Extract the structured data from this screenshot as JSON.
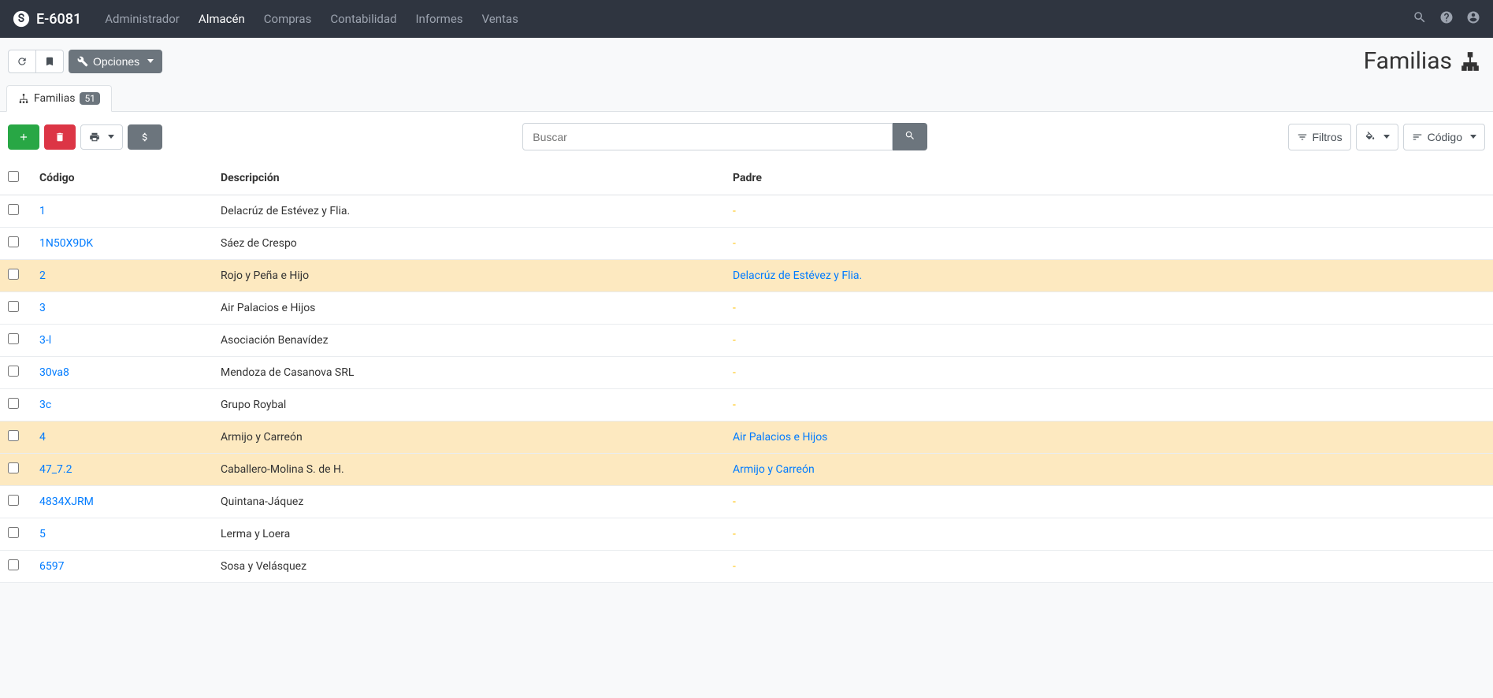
{
  "brand": "E-6081",
  "nav": [
    {
      "label": "Administrador",
      "active": false
    },
    {
      "label": "Almacén",
      "active": true
    },
    {
      "label": "Compras",
      "active": false
    },
    {
      "label": "Contabilidad",
      "active": false
    },
    {
      "label": "Informes",
      "active": false
    },
    {
      "label": "Ventas",
      "active": false
    }
  ],
  "toolbar": {
    "opciones": "Opciones"
  },
  "page_title": "Familias",
  "tab": {
    "label": "Familias",
    "count": "51"
  },
  "search": {
    "placeholder": "Buscar"
  },
  "filters": {
    "filtros": "Filtros",
    "codigo": "Código"
  },
  "columns": {
    "codigo": "Código",
    "descripcion": "Descripción",
    "padre": "Padre"
  },
  "rows": [
    {
      "codigo": "1",
      "descripcion": "Delacrúz de Estévez y Flia.",
      "padre": "-",
      "highlight": false
    },
    {
      "codigo": "1N50X9DK",
      "descripcion": "Sáez de Crespo",
      "padre": "-",
      "highlight": false
    },
    {
      "codigo": "2",
      "descripcion": "Rojo y Peña e Hijo",
      "padre": "Delacrúz de Estévez y Flia.",
      "highlight": true
    },
    {
      "codigo": "3",
      "descripcion": "Air Palacios e Hijos",
      "padre": "-",
      "highlight": false
    },
    {
      "codigo": "3-l",
      "descripcion": "Asociación Benavídez",
      "padre": "-",
      "highlight": false
    },
    {
      "codigo": "30va8",
      "descripcion": "Mendoza de Casanova SRL",
      "padre": "-",
      "highlight": false
    },
    {
      "codigo": "3c",
      "descripcion": "Grupo Roybal",
      "padre": "-",
      "highlight": false
    },
    {
      "codigo": "4",
      "descripcion": "Armijo y Carreón",
      "padre": "Air Palacios e Hijos",
      "highlight": true
    },
    {
      "codigo": "47_7.2",
      "descripcion": "Caballero-Molina S. de H.",
      "padre": "Armijo y Carreón",
      "highlight": true
    },
    {
      "codigo": "4834XJRM",
      "descripcion": "Quintana-Jáquez",
      "padre": "-",
      "highlight": false
    },
    {
      "codigo": "5",
      "descripcion": "Lerma y Loera",
      "padre": "-",
      "highlight": false
    },
    {
      "codigo": "6597",
      "descripcion": "Sosa y Velásquez",
      "padre": "-",
      "highlight": false
    }
  ]
}
